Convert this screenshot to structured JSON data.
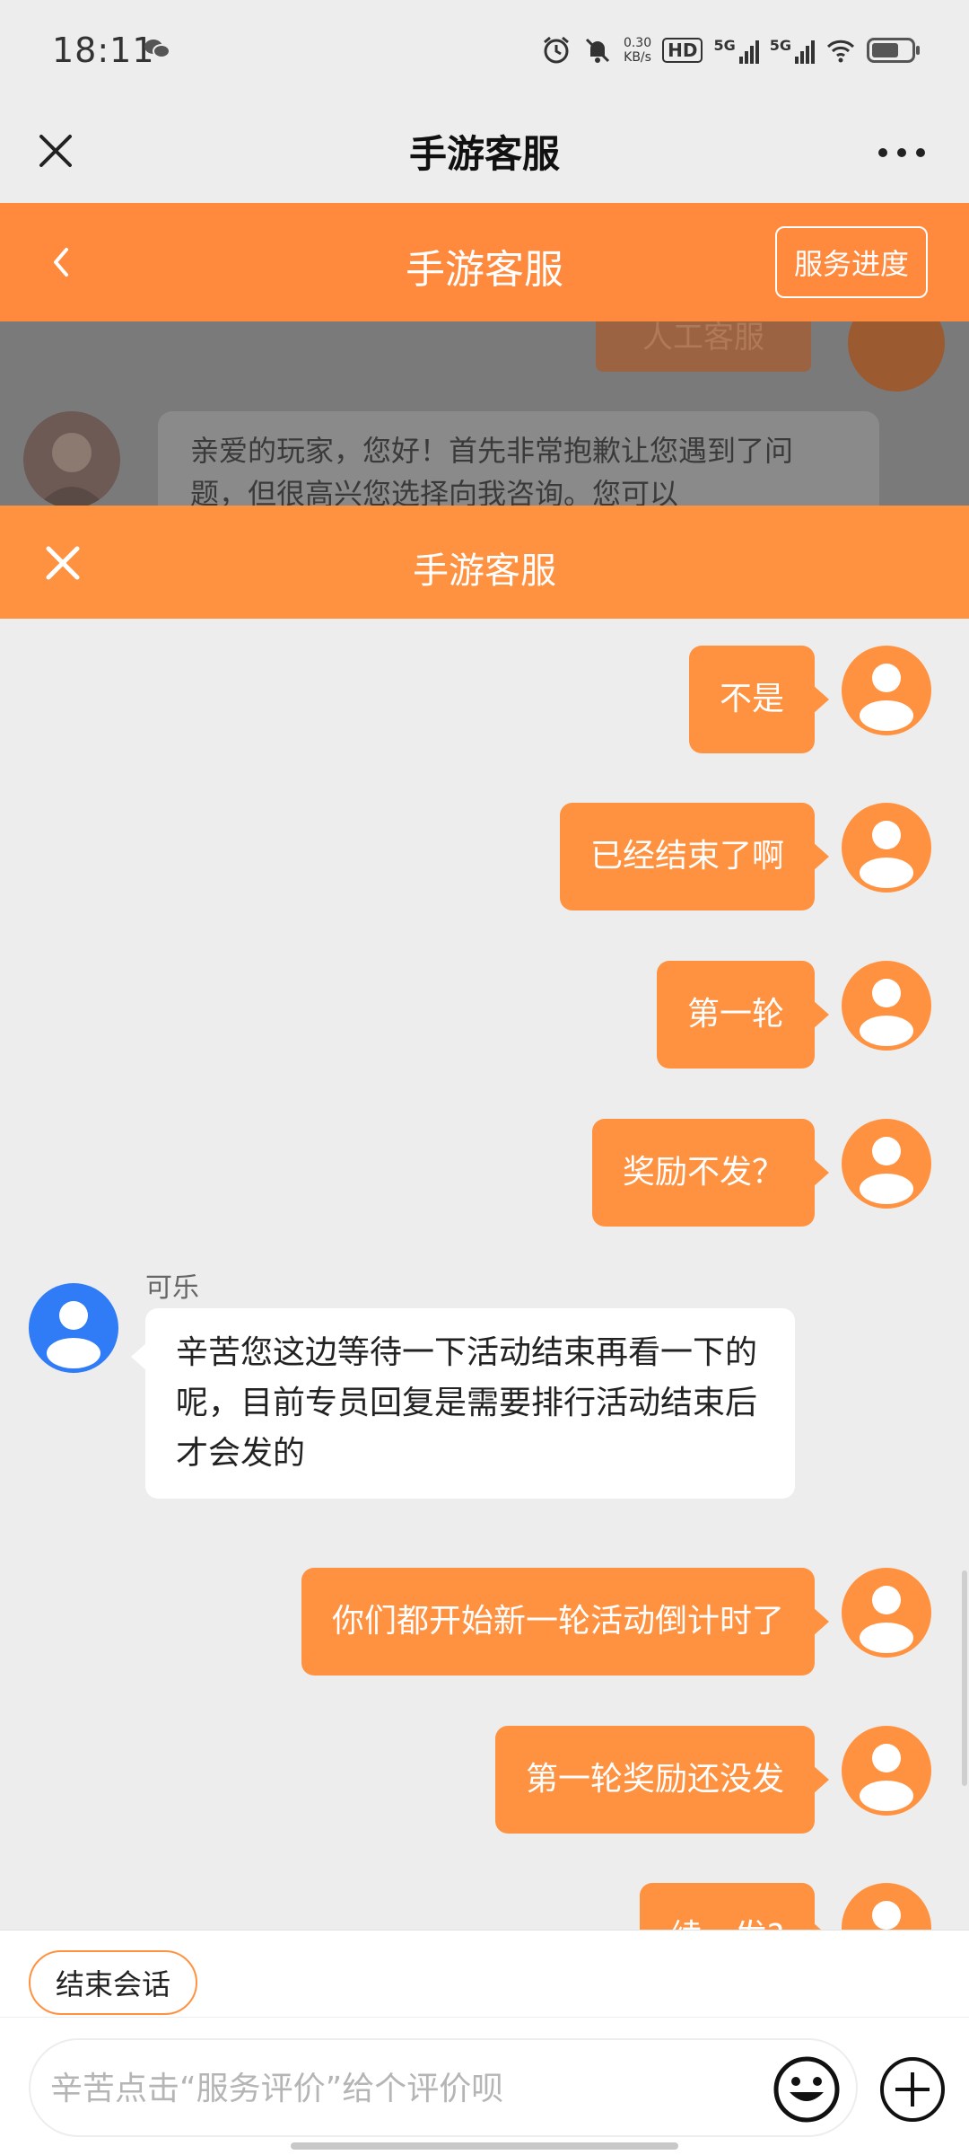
{
  "status_bar": {
    "time": "18:11",
    "net_speed_value": "0.30",
    "net_speed_unit": "KB/s",
    "hd_label": "HD",
    "sim1": "5G",
    "sim2": "5G",
    "battery_level": 0.7
  },
  "wechat_bar": {
    "title": "手游客服"
  },
  "app_header": {
    "title": "手游客服",
    "progress_button": "服务进度"
  },
  "background_chat": {
    "human_agent_bubble": "人工客服",
    "greeting": "亲爱的玩家，您好！首先非常抱歉让您遇到了问题，但很高兴您选择向我咨询。您可以"
  },
  "overlay_header": {
    "title": "手游客服"
  },
  "messages": [
    {
      "from": "me",
      "text": "不是"
    },
    {
      "from": "me",
      "text": "已经结束了啊"
    },
    {
      "from": "me",
      "text": "第一轮"
    },
    {
      "from": "me",
      "text": "奖励不发？"
    },
    {
      "from": "agent",
      "name": "可乐",
      "text": "辛苦您这边等待一下活动结束再看一下的呢，目前专员回复是需要排行活动结束后才会发的"
    },
    {
      "from": "me",
      "text": "你们都开始新一轮活动倒计时了"
    },
    {
      "from": "me",
      "text": "第一轮奖励还没发"
    },
    {
      "from": "me",
      "text": "续一发?"
    }
  ],
  "bottom_bar": {
    "end_session": "结束会话",
    "input_placeholder": "辛苦点击“服务评价”给个评价呗"
  },
  "colors": {
    "accent": "#ff9240",
    "header": "#ff8a3d",
    "agent_avatar": "#2f7cf6"
  }
}
